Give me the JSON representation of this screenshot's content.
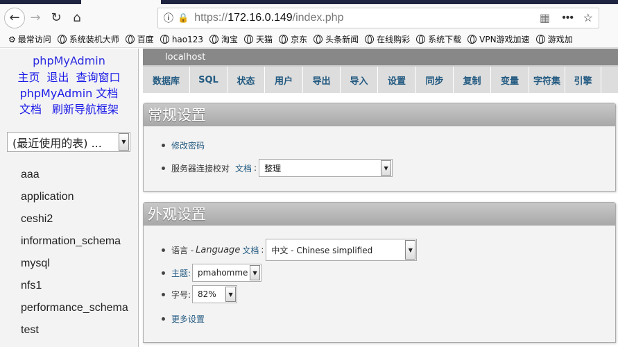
{
  "browser": {
    "url_scheme": "https://",
    "url_host": "172.16.0.149",
    "url_path": "/index.php",
    "bookmarks": [
      "最常访问",
      "系统装机大师",
      "百度",
      "hao123",
      "淘宝",
      "天猫",
      "京东",
      "头条新闻",
      "在线购彩",
      "系统下载",
      "VPN游戏加速",
      "游戏加"
    ]
  },
  "sidebar": {
    "logo": "phpMyAdmin",
    "links": [
      "主页",
      "退出",
      "查询窗口",
      "phpMyAdmin 文档",
      "文档",
      "刷新导航框架"
    ],
    "recent_tables": "(最近使用的表) ...",
    "databases": [
      "aaa",
      "application",
      "ceshi2",
      "information_schema",
      "mysql",
      "nfs1",
      "performance_schema",
      "test"
    ]
  },
  "main": {
    "server": "localhost",
    "tabs": [
      "数据库",
      "SQL",
      "状态",
      "用户",
      "导出",
      "导入",
      "设置",
      "同步",
      "复制",
      "变量",
      "字符集",
      "引擎"
    ],
    "general": {
      "title": "常规设置",
      "change_password": "修改密码",
      "collation_label": "服务器连接校对",
      "doc": "文档",
      "colon": ":",
      "collation_value": "整理"
    },
    "appearance": {
      "title": "外观设置",
      "lang_label": "语言 - ",
      "lang_italic": "Language",
      "doc": "文档",
      "colon": ":",
      "lang_value": "中文 - Chinese simplified",
      "theme_label": "主题:",
      "theme_value": "pmahomme",
      "font_label": "字号:",
      "font_value": "82%",
      "more": "更多设置"
    }
  }
}
